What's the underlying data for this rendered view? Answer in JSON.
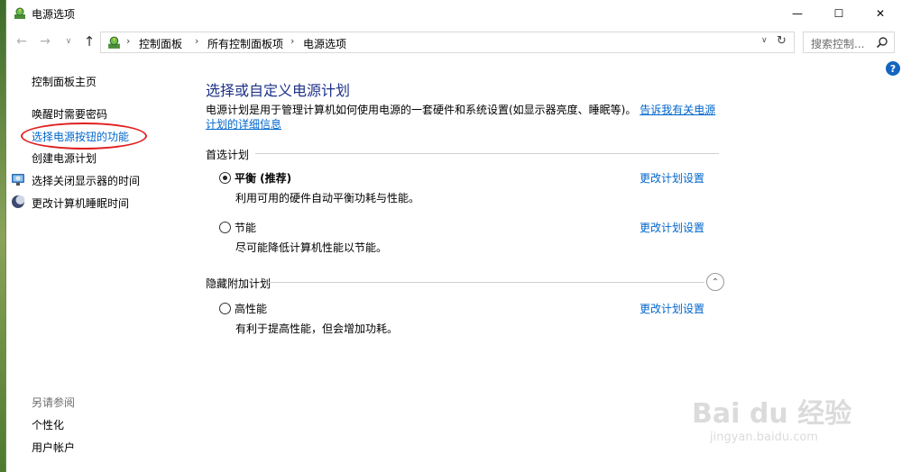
{
  "window": {
    "title": "电源选项",
    "controls": {
      "minimize": "—",
      "maximize": "☐",
      "close": "✕"
    }
  },
  "nav": {
    "back": "←",
    "forward": "→",
    "history": "∨",
    "up": "↑",
    "breadcrumb": [
      "控制面板",
      "所有控制面板项",
      "电源选项"
    ],
    "separator": "›",
    "dropdown": "∨",
    "refresh": "↻"
  },
  "search": {
    "placeholder": "搜索控制..."
  },
  "help": {
    "label": "?"
  },
  "sidebar": {
    "home": "控制面板主页",
    "items": [
      {
        "label": "唤醒时需要密码",
        "icon": ""
      },
      {
        "label": "选择电源按钮的功能",
        "icon": ""
      },
      {
        "label": "创建电源计划",
        "icon": ""
      },
      {
        "label": "选择关闭显示器的时间",
        "icon": "monitor-icon"
      },
      {
        "label": "更改计算机睡眠时间",
        "icon": "moon-icon"
      }
    ],
    "see_also": {
      "heading": "另请参阅",
      "items": [
        "个性化",
        "用户帐户"
      ]
    }
  },
  "main": {
    "title": "选择或自定义电源计划",
    "description": "电源计划是用于管理计算机如何使用电源的一套硬件和系统设置(如显示器亮度、睡眠等)。",
    "description_link": "告诉我有关电源计划的详细信息",
    "preferred_heading": "首选计划",
    "hidden_heading": "隐藏附加计划",
    "change_link": "更改计划设置",
    "plans": [
      {
        "name": "平衡 (推荐)",
        "desc": "利用可用的硬件自动平衡功耗与性能。",
        "selected": true
      },
      {
        "name": "节能",
        "desc": "尽可能降低计算机性能以节能。",
        "selected": false
      },
      {
        "name": "高性能",
        "desc": "有利于提高性能，但会增加功耗。",
        "selected": false
      }
    ]
  },
  "watermark": {
    "text": "Bai du 经验",
    "sub": "jingyan.baidu.com"
  },
  "colors": {
    "link": "#0066cc",
    "title": "#1e3287",
    "highlight_oval": "#e02020"
  }
}
